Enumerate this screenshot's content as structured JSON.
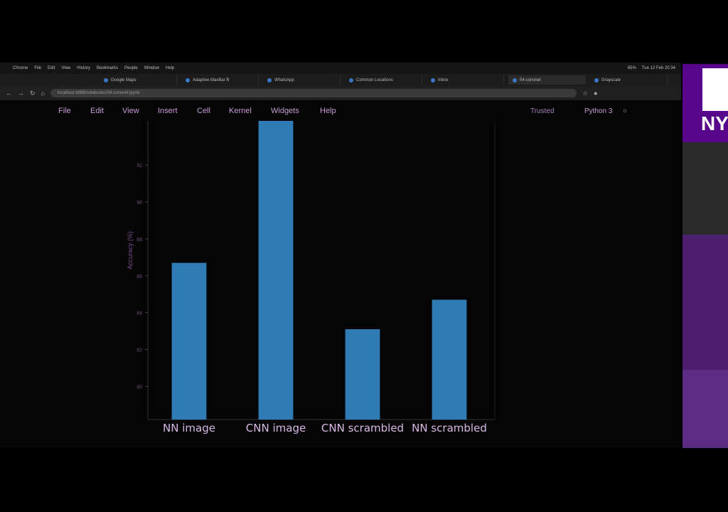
{
  "os_menubar": {
    "items": [
      "Chrome",
      "File",
      "Edit",
      "View",
      "History",
      "Bookmarks",
      "People",
      "Window",
      "Help"
    ],
    "status": [
      "65%",
      "Tue 12 Feb 20:34"
    ]
  },
  "browser": {
    "tabs": [
      {
        "label": "Google Maps"
      },
      {
        "label": "Adaptive MaxBar B"
      },
      {
        "label": "WhatsApp"
      },
      {
        "label": "Common Locations"
      },
      {
        "label": "Inbox"
      },
      {
        "label": "04-convnet"
      },
      {
        "label": "Grayscale"
      }
    ],
    "url": "localhost:8888/notebooks/04-convnet.ipynb"
  },
  "jupyter": {
    "menu": [
      "File",
      "Edit",
      "View",
      "Insert",
      "Cell",
      "Kernel",
      "Widgets",
      "Help"
    ],
    "trusted": "Trusted",
    "kernel": "Python 3"
  },
  "chart_data": {
    "type": "bar",
    "categories": [
      "NN image",
      "CNN image",
      "CNN scrambled",
      "NN scrambled"
    ],
    "values": [
      86.7,
      94.4,
      83.1,
      84.7
    ],
    "ylabel": "Accuracy (%)",
    "ylim": [
      78.2,
      94.4
    ],
    "yticks": [
      80,
      82,
      84,
      86,
      88,
      90,
      92
    ],
    "bar_color": "#2f7bb5"
  },
  "colors": {
    "jupyter_menu": "#c79bd6",
    "side_brand": "#57068c"
  },
  "side_logo": "NY"
}
